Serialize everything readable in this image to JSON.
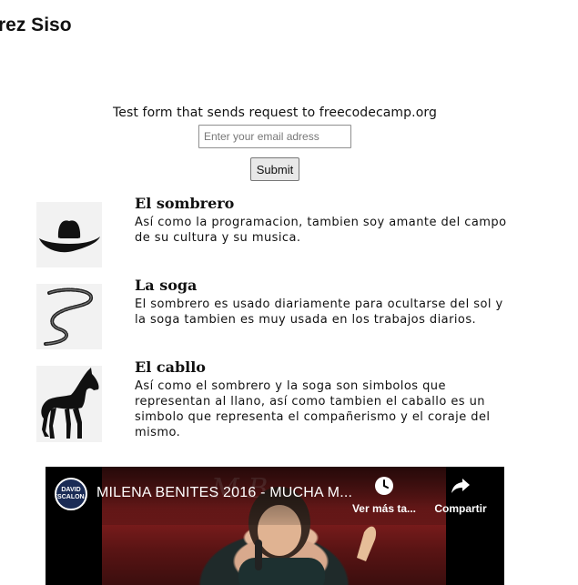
{
  "header": {
    "title": "rez Siso"
  },
  "form": {
    "caption": "Test form that sends request to freecodecamp.org",
    "email_placeholder": "Enter your email adress",
    "submit_label": "Submit"
  },
  "features": [
    {
      "title": "El sombrero",
      "description": "Así como la programacion, tambien soy amante del campo de su cultura y su musica.",
      "icon": "cowboy-hat-icon"
    },
    {
      "title": "La soga",
      "description": "El sombrero es usado diariamente para ocultarse del sol y la soga tambien es muy usada en los trabajos diarios.",
      "icon": "rope-icon"
    },
    {
      "title": "El cabllo",
      "description": "Así como el sombrero y la soga son simbolos que representan al llano, así como tambien el caballo es un simbolo que representa el compañerismo y el coraje del mismo.",
      "icon": "horse-icon"
    }
  ],
  "video": {
    "title": "MILENA BENITES 2016 - MUCHA M...",
    "channel_logo": "DAVID ESCALONA",
    "watch_later_label": "Ver más ta...",
    "share_label": "Compartir",
    "watch_later_icon": "clock-icon",
    "share_icon": "share-arrow-icon"
  }
}
